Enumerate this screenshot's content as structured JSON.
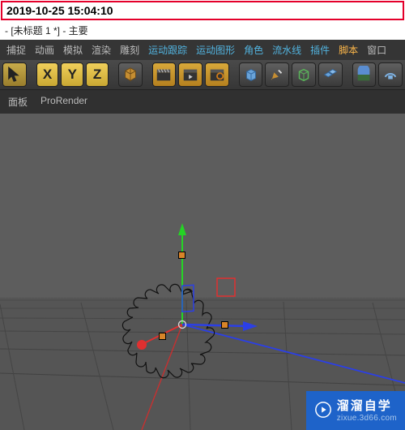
{
  "timestamp": "2019-10-25 15:04:10",
  "window_title": "- [未标题 1 *] - 主要",
  "menus": {
    "capture": "捕捉",
    "animation": "动画",
    "simulate": "模拟",
    "render": "渲染",
    "sculpt": "雕刻",
    "motion_tracker": "运动跟踪",
    "motion_graphics": "运动图形",
    "character": "角色",
    "pipeline": "流水线",
    "plugins": "插件",
    "scripts": "脚本",
    "window": "窗口"
  },
  "axis_labels": {
    "x": "X",
    "y": "Y",
    "z": "Z"
  },
  "subbar": {
    "panel": "面板",
    "prorender": "ProRender"
  },
  "watermark": {
    "brand": "溜溜自学",
    "site": "zixue.3d66.com"
  }
}
